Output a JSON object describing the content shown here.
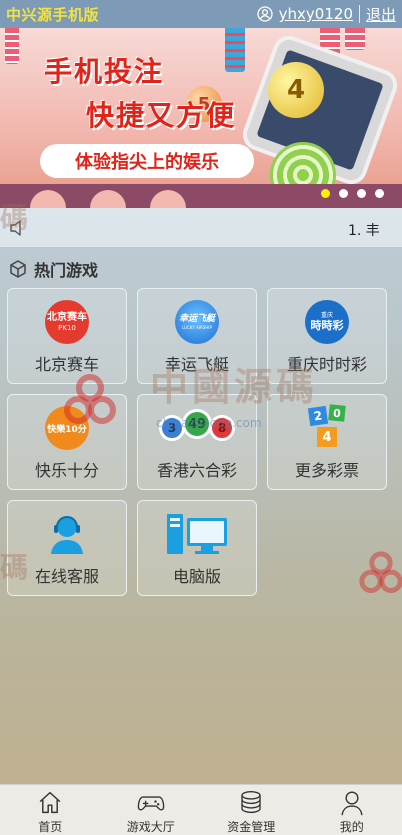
{
  "header": {
    "brand": "中兴源手机版",
    "username": "yhxy0120",
    "logout": "退出"
  },
  "banner": {
    "title1": "手机投注",
    "title2": "快捷又方便",
    "slogan": "体验指尖上的娱乐",
    "balls": [
      "5",
      "4"
    ],
    "slides": 4,
    "active_slide": 0
  },
  "notice": {
    "text": "1. 丰"
  },
  "section": {
    "title": "热门游戏"
  },
  "games": [
    {
      "label": "北京赛车",
      "icon": "pk10-logo",
      "logo_text": "北京赛车",
      "logo_sub": "PK10"
    },
    {
      "label": "幸运飞艇",
      "icon": "airship-logo",
      "logo_text": "幸运飞艇",
      "logo_sub": "LUCKY AIRSHIP"
    },
    {
      "label": "重庆时时彩",
      "icon": "ssc-logo",
      "logo_text": "時時彩",
      "logo_sub": "重庆"
    },
    {
      "label": "快乐十分",
      "icon": "happy10-logo",
      "logo_text": "快樂10分"
    },
    {
      "label": "香港六合彩",
      "icon": "lottery-balls-icon",
      "balls": [
        "3",
        "49",
        "8"
      ]
    },
    {
      "label": "更多彩票",
      "icon": "number-tiles-icon",
      "tiles": [
        "2",
        "0",
        "4"
      ]
    },
    {
      "label": "在线客服",
      "icon": "support-agent-icon"
    },
    {
      "label": "电脑版",
      "icon": "desktop-computer-icon"
    }
  ],
  "watermark": {
    "text": "中國源碼",
    "url": "chinazhaode.com",
    "left": "碼"
  },
  "tabbar": [
    {
      "label": "首页",
      "icon": "home-icon"
    },
    {
      "label": "游戏大厅",
      "icon": "gamepad-icon"
    },
    {
      "label": "资金管理",
      "icon": "coins-icon"
    },
    {
      "label": "我的",
      "icon": "user-icon"
    }
  ]
}
